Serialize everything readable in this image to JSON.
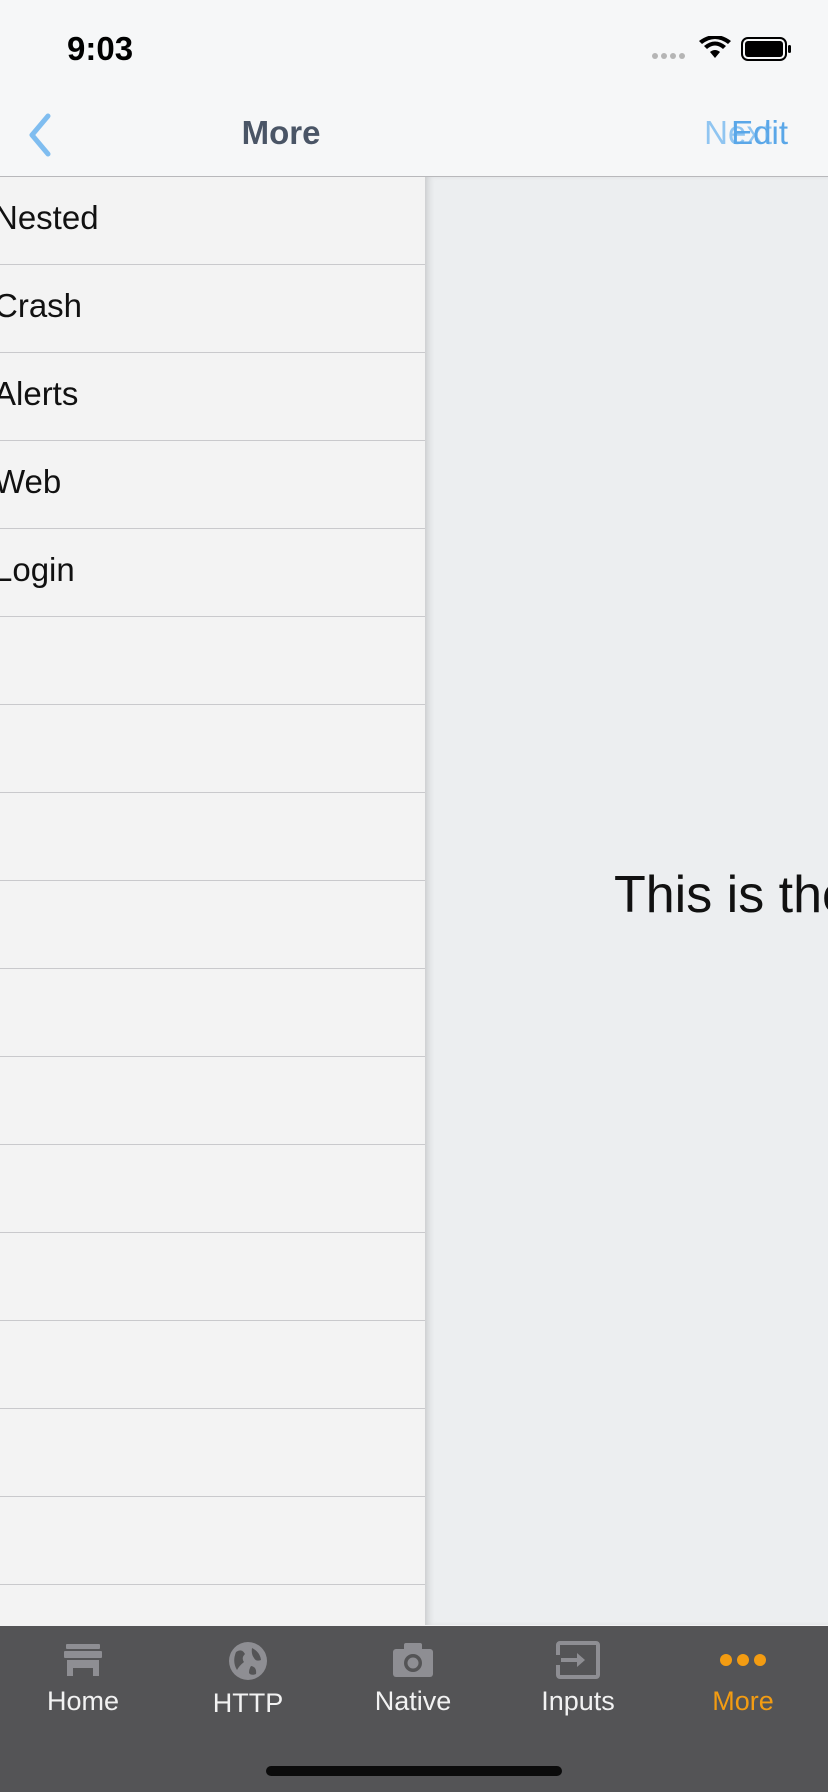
{
  "status_bar": {
    "time": "9:03"
  },
  "nav": {
    "back_icon": "chevron-left-icon",
    "title": "More",
    "right_button_ghost": "Next",
    "right_button": "Edit"
  },
  "list": {
    "items": [
      {
        "label": "Nested"
      },
      {
        "label": "Crash"
      },
      {
        "label": "Alerts"
      },
      {
        "label": "Web"
      },
      {
        "label": "Login"
      }
    ]
  },
  "detail": {
    "text": "This is the"
  },
  "tabs": [
    {
      "label": "Home",
      "icon": "storefront-icon",
      "active": false
    },
    {
      "label": "HTTP",
      "icon": "globe-icon",
      "active": false
    },
    {
      "label": "Native",
      "icon": "camera-icon",
      "active": false
    },
    {
      "label": "Inputs",
      "icon": "input-icon",
      "active": false
    },
    {
      "label": "More",
      "icon": "more-dots-icon",
      "active": true
    }
  ],
  "colors": {
    "accent": "#f39c12",
    "link": "#5aa7e8",
    "tabbar_bg": "#545456"
  }
}
